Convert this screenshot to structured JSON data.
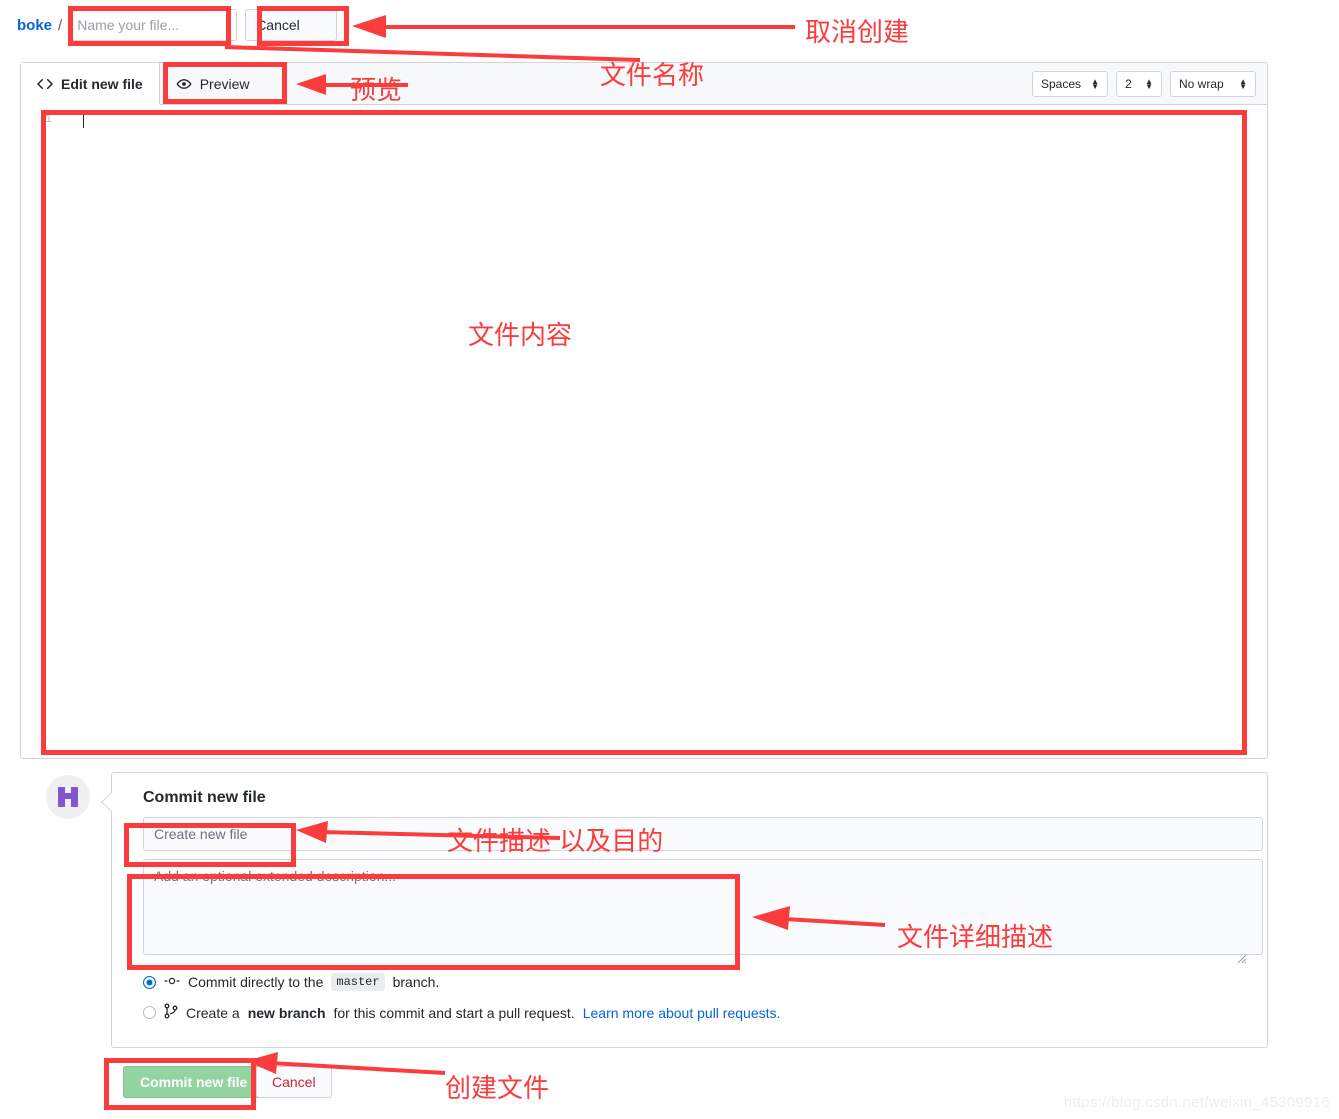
{
  "breadcrumb": {
    "repo": "boke",
    "separator": "/",
    "filename_placeholder": "Name your file...",
    "filename_value": "",
    "cancel_label": "Cancel"
  },
  "editor": {
    "tabs": [
      {
        "label": "Edit new file",
        "icon": "code-icon",
        "active": true
      },
      {
        "label": "Preview",
        "icon": "eye-icon",
        "active": false
      }
    ],
    "controls": [
      {
        "name": "indent-mode-select",
        "value": "Spaces"
      },
      {
        "name": "indent-size-select",
        "value": "2"
      },
      {
        "name": "wrap-mode-select",
        "value": "No wrap"
      }
    ],
    "line_number": "1",
    "content": ""
  },
  "commit": {
    "title": "Commit new file",
    "summary_placeholder": "Create new file",
    "summary_value": "",
    "description_placeholder": "Add an optional extended description...",
    "description_value": "",
    "options": [
      {
        "name": "commit-directly-option",
        "selected": true,
        "icon": "git-commit-icon",
        "text_before": "Commit directly to the",
        "branch": "master",
        "text_after": "branch."
      },
      {
        "name": "create-branch-option",
        "selected": false,
        "icon": "git-branch-icon",
        "text_before": "Create a",
        "bold": "new branch",
        "text_after": "for this commit and start a pull request.",
        "link": "Learn more about pull requests."
      }
    ],
    "submit_label": "Commit new file",
    "cancel_label": "Cancel"
  },
  "annotations": {
    "color": "#fa3c3c",
    "labels": [
      {
        "id": "cancel-create",
        "text": "取消创建"
      },
      {
        "id": "file-name",
        "text": "文件名称"
      },
      {
        "id": "preview",
        "text": "预览"
      },
      {
        "id": "file-content",
        "text": "文件内容"
      },
      {
        "id": "file-description",
        "text": "文件描述 以及目的"
      },
      {
        "id": "file-detail-description",
        "text": "文件详细描述"
      },
      {
        "id": "create-file",
        "text": "创建文件"
      }
    ]
  },
  "watermark": "https://blog.csdn.net/weixin_45309916"
}
